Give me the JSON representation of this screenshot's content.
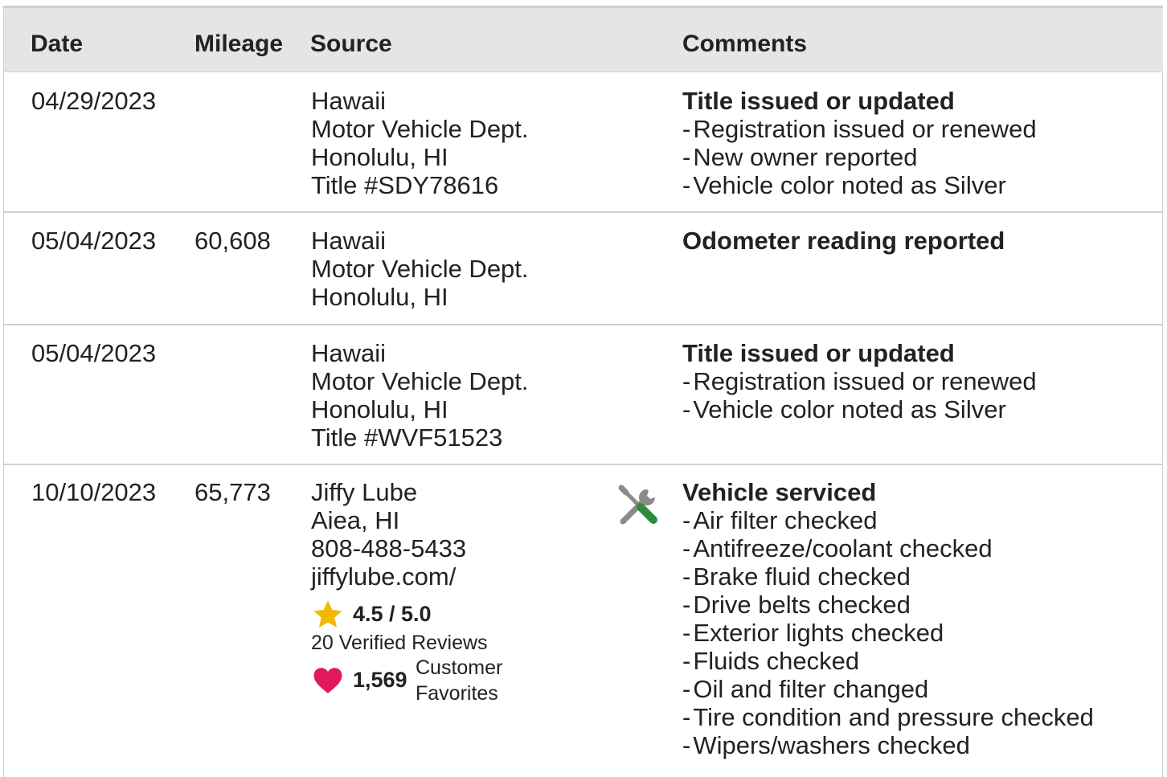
{
  "header": {
    "date": "Date",
    "mileage": "Mileage",
    "source": "Source",
    "comments": "Comments"
  },
  "rows": [
    {
      "date": "04/29/2023",
      "mileage": "",
      "source": [
        "Hawaii",
        "Motor Vehicle Dept.",
        "Honolulu, HI",
        "Title #SDY78616"
      ],
      "comment_title": "Title issued or updated",
      "comment_items": [
        "Registration issued or renewed",
        "New owner reported",
        "Vehicle color noted as Silver"
      ]
    },
    {
      "date": "05/04/2023",
      "mileage": "60,608",
      "source": [
        "Hawaii",
        "Motor Vehicle Dept.",
        "Honolulu, HI"
      ],
      "comment_title": "Odometer reading reported",
      "comment_items": []
    },
    {
      "date": "05/04/2023",
      "mileage": "",
      "source": [
        "Hawaii",
        "Motor Vehicle Dept.",
        "Honolulu, HI",
        "Title #WVF51523"
      ],
      "comment_title": "Title issued or updated",
      "comment_items": [
        "Registration issued or renewed",
        "Vehicle color noted as Silver"
      ]
    },
    {
      "date": "10/10/2023",
      "mileage": "65,773",
      "source": [
        "Jiffy Lube",
        "Aiea, HI",
        "808-488-5433",
        "jiffylube.com/"
      ],
      "rating": "4.5 / 5.0",
      "reviews": "20 Verified Reviews",
      "favorites_count": "1,569",
      "favorites_label_1": "Customer",
      "favorites_label_2": "Favorites",
      "comment_icon": "wrench-screwdriver-icon",
      "comment_title": "Vehicle serviced",
      "comment_items": [
        "Air filter checked",
        "Antifreeze/coolant checked",
        "Brake fluid checked",
        "Drive belts checked",
        "Exterior lights checked",
        "Fluids checked",
        "Oil and filter changed",
        "Tire condition and pressure checked",
        "Wipers/washers checked"
      ]
    }
  ],
  "colors": {
    "header_bg": "#e5e5e5",
    "border": "#cfcfcf",
    "star": "#f5b800",
    "heart": "#e0195f",
    "tool_green": "#2e8b3a",
    "tool_gray": "#8a8a8a"
  }
}
